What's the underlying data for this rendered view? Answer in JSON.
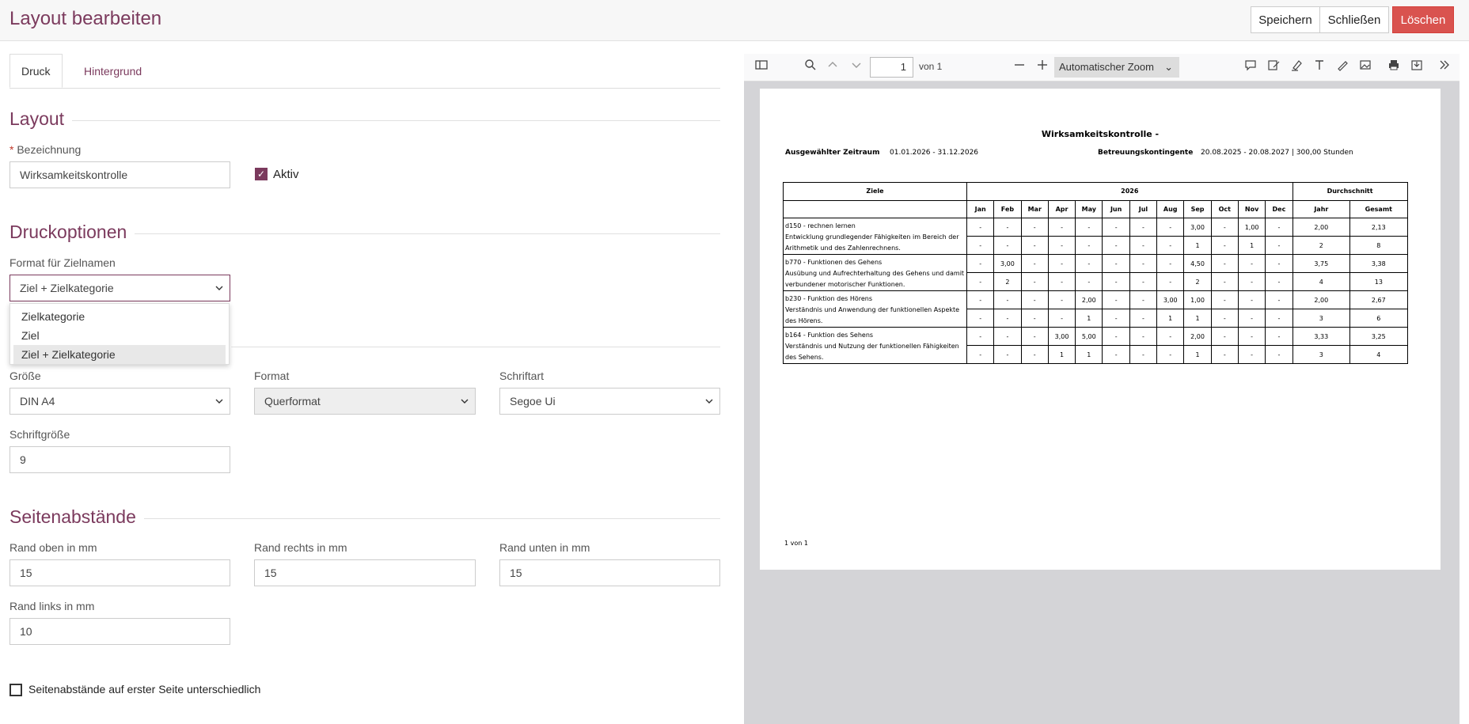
{
  "header": {
    "title": "Layout bearbeiten",
    "save": "Speichern",
    "close": "Schließen",
    "delete": "Löschen"
  },
  "tabs": {
    "print": "Druck",
    "background": "Hintergrund"
  },
  "layout": {
    "section": "Layout",
    "name_required": "*",
    "name_label": "Bezeichnung",
    "name_value": "Wirksamkeitskontrolle",
    "active_label": "Aktiv"
  },
  "print_options": {
    "section": "Druckoptionen",
    "format_label": "Format für Zielnamen",
    "format_value": "Ziel + Zielkategorie",
    "format_options": [
      "Zielkategorie",
      "Ziel",
      "Ziel + Zielkategorie"
    ],
    "size_label": "Größe",
    "size_value": "DIN A4",
    "orientation_label": "Format",
    "orientation_value": "Querformat",
    "font_label": "Schriftart",
    "font_value": "Segoe Ui",
    "fontsize_label": "Schriftgröße",
    "fontsize_value": "9"
  },
  "margins": {
    "section": "Seitenabstände",
    "top_label": "Rand oben in mm",
    "top_value": "15",
    "right_label": "Rand rechts in mm",
    "right_value": "15",
    "bottom_label": "Rand unten in mm",
    "bottom_value": "15",
    "left_label": "Rand links in mm",
    "left_value": "10",
    "first_page_label": "Seitenabstände auf erster Seite unterschiedlich"
  },
  "viewer": {
    "page": "1",
    "of": "von 1",
    "zoom": "Automatischer Zoom"
  },
  "report": {
    "title": "Wirksamkeitskontrolle -",
    "period_label": "Ausgewählter Zeitraum",
    "period_value": "01.01.2026 - 31.12.2026",
    "quota_label": "Betreuungskontingente",
    "quota_value": "20.08.2025 - 20.08.2027 | 300,00 Stunden",
    "col_goals": "Ziele",
    "col_year": "2026",
    "col_avg": "Durchschnitt",
    "months": [
      "Jan",
      "Feb",
      "Mar",
      "Apr",
      "May",
      "Jun",
      "Jul",
      "Aug",
      "Sep",
      "Oct",
      "Nov",
      "Dec"
    ],
    "avg_cols": [
      "Jahr",
      "Gesamt"
    ],
    "rows": [
      {
        "goal": "d150 - rechnen lernen",
        "desc": "Entwicklung grundlegender Fähigkeiten im Bereich der Arithmetik und des Zahlenrechnens.",
        "r1": [
          "-",
          "-",
          "-",
          "-",
          "-",
          "-",
          "-",
          "-",
          "3,00",
          "-",
          "1,00",
          "-",
          "2,00",
          "2,13"
        ],
        "r2": [
          "-",
          "-",
          "-",
          "-",
          "-",
          "-",
          "-",
          "-",
          "1",
          "-",
          "1",
          "-",
          "2",
          "8"
        ]
      },
      {
        "goal": "b770 - Funktionen des Gehens",
        "desc": "Ausübung und Aufrechterhaltung des Gehens und damit verbundener motorischer Funktionen.",
        "r1": [
          "-",
          "3,00",
          "-",
          "-",
          "-",
          "-",
          "-",
          "-",
          "4,50",
          "-",
          "-",
          "-",
          "3,75",
          "3,38"
        ],
        "r2": [
          "-",
          "2",
          "-",
          "-",
          "-",
          "-",
          "-",
          "-",
          "2",
          "-",
          "-",
          "-",
          "4",
          "13"
        ]
      },
      {
        "goal": "b230 - Funktion des Hörens",
        "desc": "Verständnis und Anwendung der funktionellen Aspekte des Hörens.",
        "r1": [
          "-",
          "-",
          "-",
          "-",
          "2,00",
          "-",
          "-",
          "3,00",
          "1,00",
          "-",
          "-",
          "-",
          "2,00",
          "2,67"
        ],
        "r2": [
          "-",
          "-",
          "-",
          "-",
          "1",
          "-",
          "-",
          "1",
          "1",
          "-",
          "-",
          "-",
          "3",
          "6"
        ]
      },
      {
        "goal": "b164 - Funktion des Sehens",
        "desc": "Verständnis und Nutzung der funktionellen Fähigkeiten des Sehens.",
        "r1": [
          "-",
          "-",
          "-",
          "3,00",
          "5,00",
          "-",
          "-",
          "-",
          "2,00",
          "-",
          "-",
          "-",
          "3,33",
          "3,25"
        ],
        "r2": [
          "-",
          "-",
          "-",
          "1",
          "1",
          "-",
          "-",
          "-",
          "1",
          "-",
          "-",
          "-",
          "3",
          "4"
        ]
      }
    ],
    "footer": "1 von 1"
  }
}
